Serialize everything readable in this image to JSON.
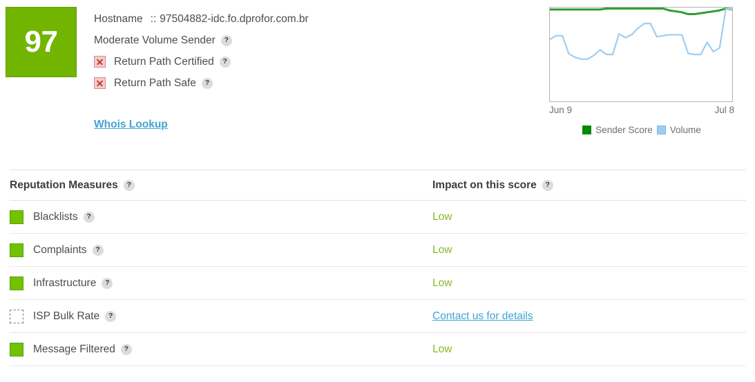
{
  "summary": {
    "score": "97",
    "score_color": "#72b500",
    "hostname_label": "Hostname",
    "hostname_separator": "::",
    "hostname_value": "97504882-idc.fo.dprofor.com.br",
    "volume_label": "Moderate  Volume Sender",
    "certifications": [
      {
        "label": "Return Path Certified",
        "status_icon": "x-mark-icon",
        "certified": false
      },
      {
        "label": "Return Path Safe",
        "status_icon": "x-mark-icon",
        "certified": false
      }
    ],
    "whois_link": "Whois Lookup",
    "help_glyph": "?"
  },
  "chart_data": {
    "type": "line",
    "title": "",
    "xlabel": "",
    "ylabel": "",
    "x_start_label": "Jun 9",
    "x_end_label": "Jul 8",
    "grid": false,
    "legend_position": "bottom",
    "xlim": [
      0,
      29
    ],
    "ylim": [
      0,
      100
    ],
    "x": [
      0,
      1,
      2,
      3,
      4,
      5,
      6,
      7,
      8,
      9,
      10,
      11,
      12,
      13,
      14,
      15,
      16,
      17,
      18,
      19,
      20,
      21,
      22,
      23,
      24,
      25,
      26,
      27,
      28,
      29
    ],
    "series": [
      {
        "name": "Sender Score",
        "color": "#2e9c2e",
        "values": [
          98,
          98,
          98,
          98,
          98,
          98,
          98,
          98,
          98,
          99,
          99,
          99,
          99,
          99,
          99,
          99,
          99,
          99,
          99,
          97,
          96,
          95,
          93,
          93,
          94,
          95,
          96,
          97,
          99,
          98
        ]
      },
      {
        "name": "Volume",
        "color": "#9ecdf0",
        "values": [
          66,
          70,
          70,
          51,
          47,
          45,
          45,
          49,
          55,
          50,
          50,
          72,
          68,
          71,
          78,
          83,
          83,
          69,
          70,
          71,
          71,
          71,
          51,
          50,
          50,
          63,
          53,
          57,
          99,
          98
        ]
      }
    ]
  },
  "measures_table": {
    "columns": [
      {
        "label": "Reputation Measures",
        "help_glyph": "?"
      },
      {
        "label": "Impact on this score",
        "help_glyph": "?"
      }
    ],
    "rows": [
      {
        "swatch": "green",
        "label": "Blacklists",
        "help_glyph": "?",
        "impact": "Low",
        "impact_type": "text"
      },
      {
        "swatch": "green",
        "label": "Complaints",
        "help_glyph": "?",
        "impact": "Low",
        "impact_type": "text"
      },
      {
        "swatch": "green",
        "label": "Infrastructure",
        "help_glyph": "?",
        "impact": "Low",
        "impact_type": "text"
      },
      {
        "swatch": "empty",
        "label": "ISP Bulk Rate",
        "help_glyph": "?",
        "impact": "Contact us for details",
        "impact_type": "link"
      },
      {
        "swatch": "green",
        "label": "Message Filtered",
        "help_glyph": "?",
        "impact": "Low",
        "impact_type": "text"
      }
    ]
  },
  "colors": {
    "score_green": "#72b500",
    "swatch_green": "#72c200",
    "impact_green": "#82bb23",
    "link_blue": "#3fa3d6",
    "sender_score_line": "#2e9c2e",
    "volume_line": "#9ecdf0",
    "x_mark_red": "#c0392b"
  }
}
